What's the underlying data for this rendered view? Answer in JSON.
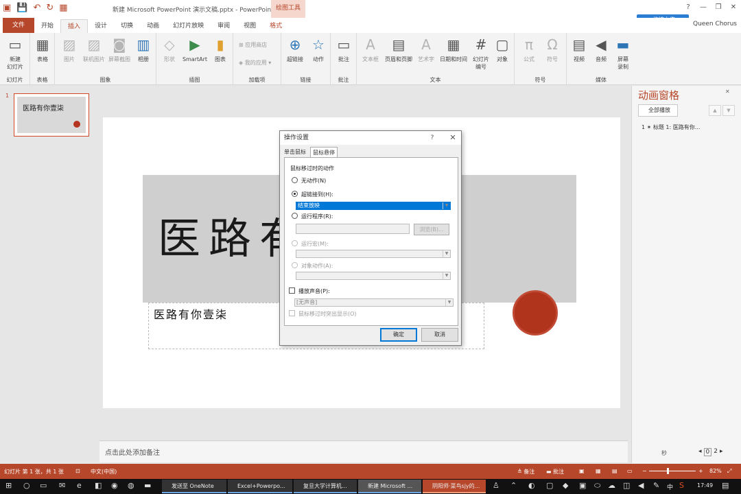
{
  "window": {
    "title": "新建 Microsoft PowerPoint 演示文稿.pptx - PowerPoint",
    "context_tools": "绘图工具",
    "help": "?",
    "controls": [
      "—",
      "❐",
      "✕"
    ]
  },
  "onedrive": "拖拽上传",
  "user": "Queen Chorus",
  "tabs": [
    "文件",
    "开始",
    "插入",
    "设计",
    "切换",
    "动画",
    "幻灯片放映",
    "审阅",
    "视图",
    "格式"
  ],
  "active_tab": "插入",
  "ribbon": {
    "groups": {
      "slides": "幻灯片",
      "tables": "表格",
      "images": "图象",
      "illustrations": "插图",
      "addins": "加载项",
      "links": "链接",
      "comments": "批注",
      "text": "文本",
      "symbols": "符号",
      "media": "媒体"
    },
    "buttons": {
      "new_slide": "新建\n幻灯片",
      "table": "表格",
      "pictures": "图片",
      "online_pictures": "联机图片",
      "screenshot": "屏幕截图",
      "album": "相册",
      "shapes": "形状",
      "smartart": "SmartArt",
      "chart": "图表",
      "store": "应用商店",
      "my_apps": "我的应用",
      "hyperlink": "超链接",
      "action": "动作",
      "comment": "批注",
      "textbox": "文本框",
      "header_footer": "页眉和页脚",
      "wordart": "艺术字",
      "date_time": "日期和时间",
      "slide_number": "幻灯片\n编号",
      "object": "对象",
      "equation": "公式",
      "symbol": "符号",
      "video": "视频",
      "audio": "音频",
      "screen_recording": "屏幕\n录制"
    }
  },
  "thumbnail": {
    "number": "1",
    "title": "医路有你壹柒"
  },
  "slide": {
    "big_title": "医路有",
    "subtitle": "医路有你壹柒"
  },
  "notes_placeholder": "点击此处添加备注",
  "anim_pane": {
    "title": "动画窗格",
    "play_all": "全部播放",
    "item": "1 ✶ 标题 1: 医路有你..."
  },
  "dialog": {
    "title": "操作设置",
    "help": "?",
    "tab_click": "单击鼠标",
    "tab_hover": "鼠标悬停",
    "section": "鼠标移过时的动作",
    "opt_none": "无动作(N)",
    "opt_hyperlink": "超链接到(H):",
    "hyperlink_value": "结束放映",
    "opt_program": "运行程序(R):",
    "browse": "浏览(B)...",
    "opt_macro": "运行宏(M):",
    "opt_object": "对象动作(A):",
    "play_sound": "播放声音(P):",
    "sound_value": "[无声音]",
    "highlight": "鼠标移过时突出显示(O)",
    "ok": "确定",
    "cancel": "取消"
  },
  "status": {
    "slide_info": "幻灯片 第 1 张，共 1 张",
    "language": "中文(中国)",
    "notes": "备注",
    "comments": "批注",
    "zoom": "82%",
    "seconds": "秒",
    "page": "0",
    "total": "2"
  },
  "taskbar": {
    "items": [
      "发送至 OneNote",
      "Excel+Powerpo...",
      "复旦大学计算机...",
      "新建 Microsoft ...",
      "阴阳师·菜鸟sjy的..."
    ],
    "lang": "中",
    "time": "17:49"
  }
}
